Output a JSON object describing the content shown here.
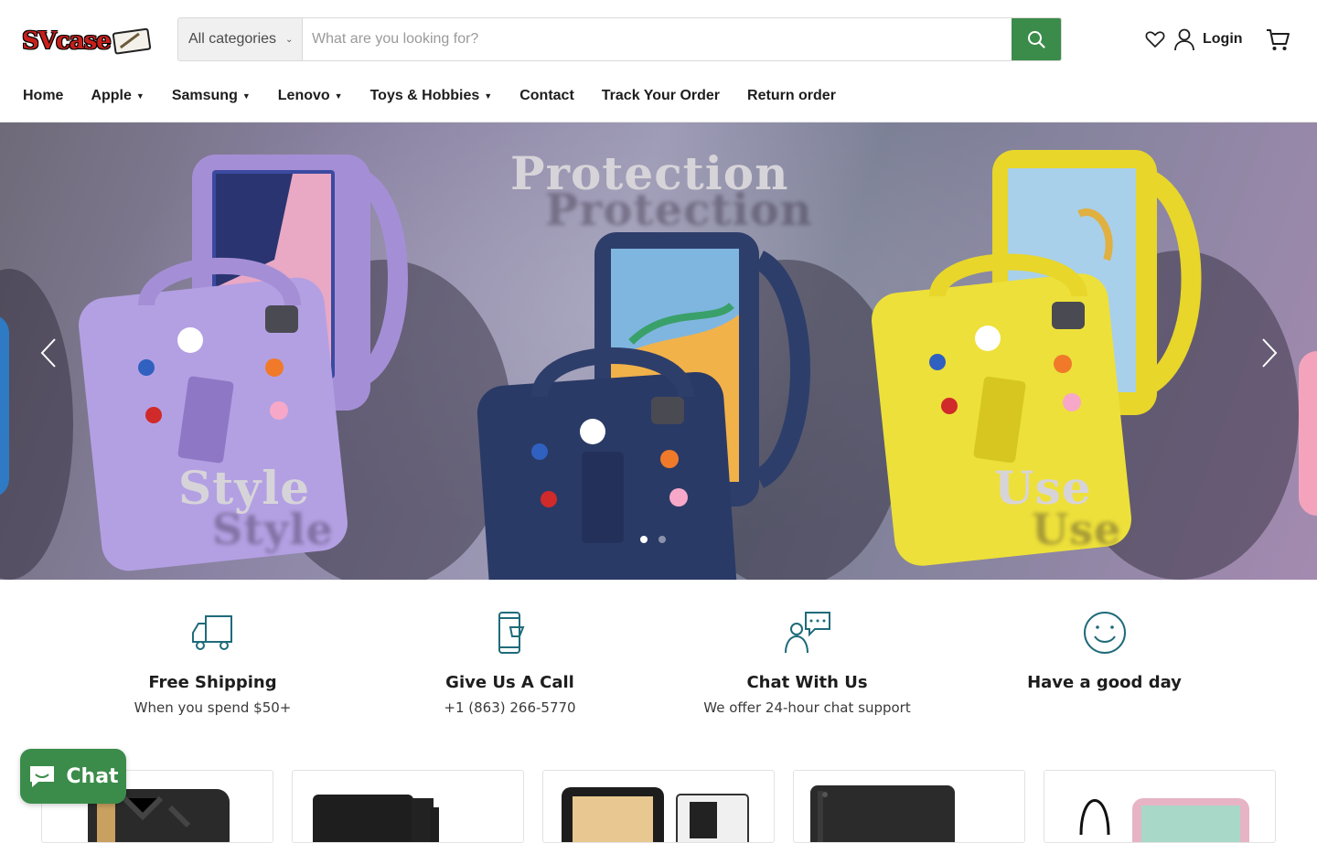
{
  "header": {
    "logo_text": "SVcase",
    "search": {
      "category_label": "All categories",
      "placeholder": "What are you looking for?"
    },
    "login_label": "Login"
  },
  "nav": {
    "items": [
      {
        "label": "Home",
        "has_dropdown": false
      },
      {
        "label": "Apple",
        "has_dropdown": true
      },
      {
        "label": "Samsung",
        "has_dropdown": true
      },
      {
        "label": "Lenovo",
        "has_dropdown": true
      },
      {
        "label": "Toys & Hobbies",
        "has_dropdown": true
      },
      {
        "label": "Contact",
        "has_dropdown": false
      },
      {
        "label": "Track Your Order",
        "has_dropdown": false
      },
      {
        "label": "Return order",
        "has_dropdown": false
      }
    ]
  },
  "hero": {
    "words": [
      "Protection",
      "Style",
      "Use"
    ],
    "slide_count": 2,
    "active_slide": 1,
    "case_colors": [
      "#a48fd6",
      "#2e3e6b",
      "#e8d62a"
    ]
  },
  "features": [
    {
      "icon": "truck-icon",
      "title": "Free Shipping",
      "subtitle": "When you spend $50+"
    },
    {
      "icon": "phone-icon",
      "title": "Give Us A Call",
      "subtitle": "+1 (863) 266-5770"
    },
    {
      "icon": "chat-support-icon",
      "title": "Chat With Us",
      "subtitle": "We offer 24-hour chat support"
    },
    {
      "icon": "smiley-icon",
      "title": "Have a good day",
      "subtitle": ""
    }
  ],
  "chat_widget": {
    "label": "Chat"
  },
  "colors": {
    "accent_green": "#3b8c4a",
    "icon_teal": "#1f6b7a"
  }
}
